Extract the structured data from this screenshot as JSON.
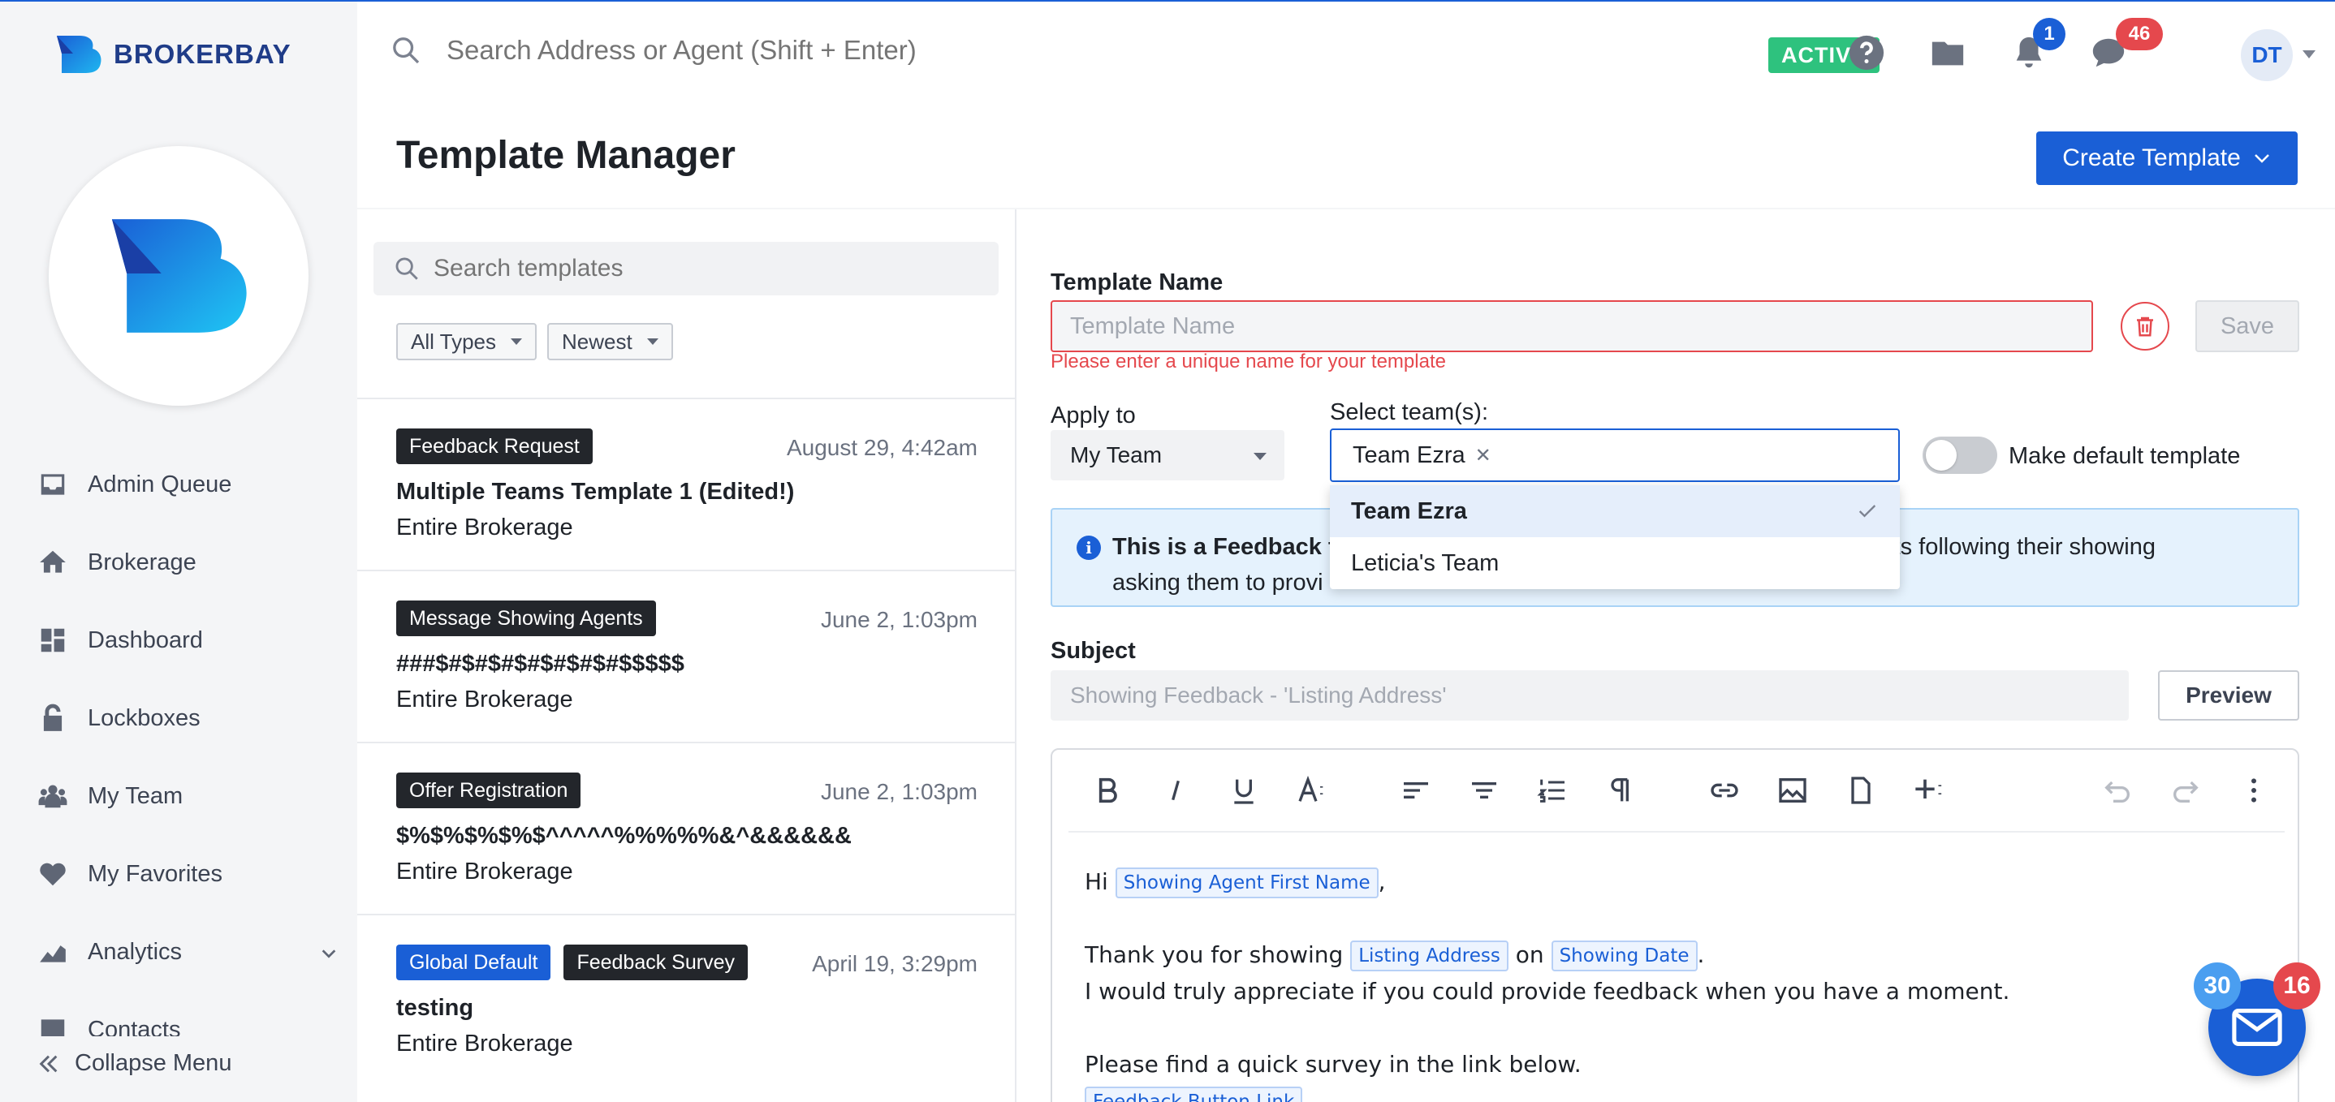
{
  "app": {
    "logo_text": "BROKERBAY"
  },
  "header": {
    "search_placeholder": "Search Address or Agent (Shift + Enter)",
    "status_badge": "ACTIVE",
    "notifications_count": "1",
    "messages_count": "46",
    "user_initials": "DT",
    "page_title": "Template Manager",
    "create_button": "Create Template"
  },
  "sidebar": {
    "items": [
      {
        "label": "Admin Queue",
        "icon": "inbox-icon"
      },
      {
        "label": "Brokerage",
        "icon": "home-icon"
      },
      {
        "label": "Dashboard",
        "icon": "dashboard-icon"
      },
      {
        "label": "Lockboxes",
        "icon": "lock-icon"
      },
      {
        "label": "My Team",
        "icon": "team-icon"
      },
      {
        "label": "My Favorites",
        "icon": "heart-icon"
      },
      {
        "label": "Analytics",
        "icon": "chart-icon"
      },
      {
        "label": "Contacts",
        "icon": "contacts-icon"
      }
    ],
    "collapse_label": "Collapse Menu"
  },
  "template_list": {
    "search_placeholder": "Search templates",
    "filter_type": "All Types",
    "filter_sort": "Newest",
    "items": [
      {
        "tags": [
          "Feedback Request"
        ],
        "date": "August 29, 4:42am",
        "name": "Multiple Teams Template 1 (Edited!)",
        "scope": "Entire Brokerage"
      },
      {
        "tags": [
          "Message Showing Agents"
        ],
        "date": "June 2, 1:03pm",
        "name": "###$#$#$#$#$#$#$#$$$$$",
        "scope": "Entire Brokerage"
      },
      {
        "tags": [
          "Offer Registration"
        ],
        "date": "June 2, 1:03pm",
        "name": "$%$%$%$%$^^^^^%%%%%&^&&&&&&",
        "scope": "Entire Brokerage"
      },
      {
        "tags": [
          "Global Default",
          "Feedback Survey"
        ],
        "date": "April 19, 3:29pm",
        "name": "testing",
        "scope": "Entire Brokerage"
      }
    ]
  },
  "editor": {
    "template_name_label": "Template Name",
    "template_name_placeholder": "Template Name",
    "template_name_error": "Please enter a unique name for your template",
    "save_label": "Save",
    "apply_to_label": "Apply to",
    "apply_to_value": "My Team",
    "select_teams_label": "Select team(s):",
    "selected_team_chip": "Team Ezra",
    "default_toggle_label": "Make default template",
    "info_bold": "This is a Feedback t",
    "info_rest_line1": "ng agents following their showing",
    "info_line2": "asking them to provi",
    "team_options": [
      {
        "label": "Team Ezra",
        "selected": true
      },
      {
        "label": "Leticia's Team",
        "selected": false
      }
    ],
    "subject_label": "Subject",
    "subject_placeholder": "Showing Feedback - 'Listing Address'",
    "preview_label": "Preview",
    "body": {
      "greeting": "Hi",
      "merge_first_name": "Showing Agent First Name",
      "comma": ",",
      "line2_a": "Thank you for showing",
      "merge_listing_address": "Listing Address",
      "line2_on": "on",
      "merge_showing_date": "Showing Date",
      "period": ".",
      "line3": "I would truly appreciate if you could provide feedback when you have a moment.",
      "line4": "Please find a quick survey in the link below.",
      "merge_feedback_link": "Feedback Button Link"
    }
  },
  "chat_widget": {
    "count_blue": "30",
    "count_red": "16"
  },
  "colors": {
    "primary": "#1a5fd6",
    "active": "#2ec27e",
    "error": "#e5484d",
    "badge_red": "#e5484d",
    "info_bg": "#e5f2fd"
  }
}
